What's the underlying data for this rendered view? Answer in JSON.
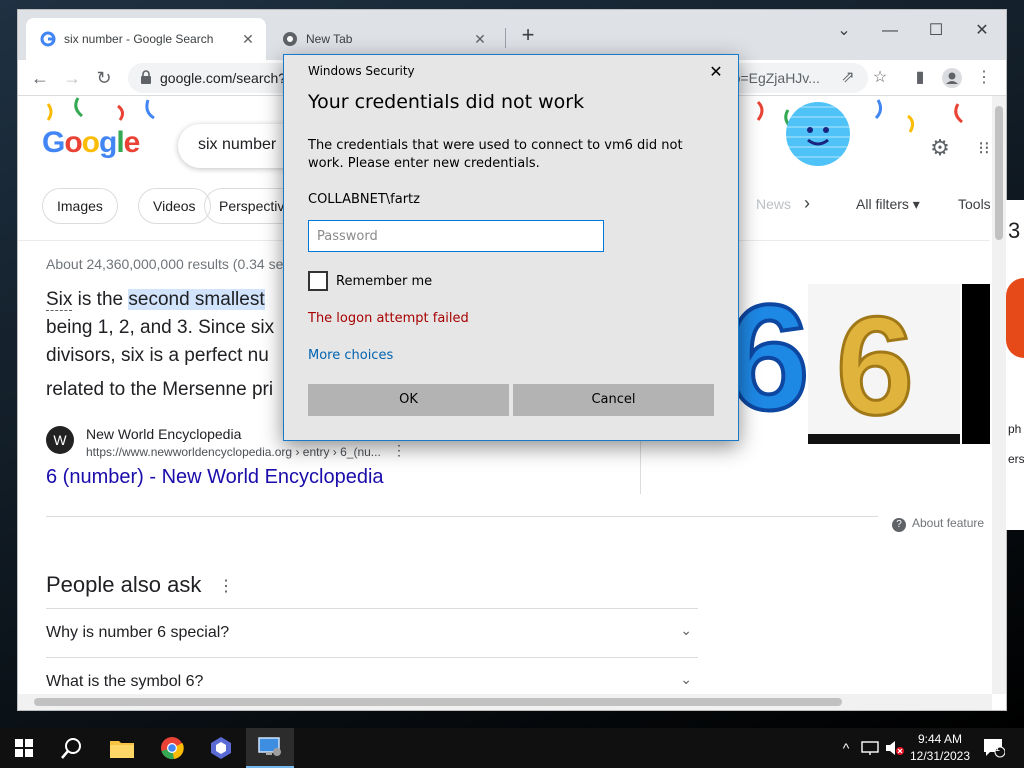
{
  "browser": {
    "tabs": [
      {
        "title": "six number - Google Search",
        "close": "✕"
      },
      {
        "title": "New Tab",
        "close": "✕"
      }
    ],
    "new_tab": "+",
    "window_controls": {
      "minimize": "—",
      "maximize": "☐",
      "close": "✕",
      "tabsearch": "⌄"
    },
    "address": {
      "url": "google.com/search?",
      "url_tail": "rp=EgZjaHJv..."
    }
  },
  "google": {
    "logo_letters": [
      {
        "ch": "G",
        "color": "#4285f4"
      },
      {
        "ch": "o",
        "color": "#ea4335"
      },
      {
        "ch": "o",
        "color": "#fbbc05"
      },
      {
        "ch": "g",
        "color": "#4285f4"
      },
      {
        "ch": "l",
        "color": "#34a853"
      },
      {
        "ch": "e",
        "color": "#ea4335"
      }
    ],
    "query": "six number",
    "chips": [
      "Images",
      "Videos",
      "Perspectiv",
      "News"
    ],
    "all_filters": "All filters",
    "tools": "Tools",
    "stats": "About 24,360,000,000 results (0.34 se",
    "snippet_lines": {
      "l1_a": "Six",
      "l1_b": " is the ",
      "l1_hl": "second smallest",
      "l2": "being 1, 2, and 3. Since six",
      "l3": "divisors, six is a perfect nu",
      "l4": "related to the Mersenne pri"
    },
    "source": {
      "logo": "W",
      "name": "New World Encyclopedia",
      "url": "https://www.newworldencyclopedia.org › entry › 6_(nu..."
    },
    "result_title": "6 (number) - New World Encyclopedia",
    "about_featured": "About feature",
    "paa_title": "People also ask",
    "paa_questions": [
      "Why is number 6 special?",
      "What is the symbol 6?"
    ],
    "side_glimpse": {
      "num": "3",
      "ph": "ph",
      "ers": "ers"
    }
  },
  "dialog": {
    "window_title": "Windows Security",
    "heading": "Your credentials did not work",
    "message": "The credentials that were used to connect to vm6 did not work. Please enter new credentials.",
    "username": "COLLABNET\\fartz",
    "password_placeholder": "Password",
    "remember_label": "Remember me",
    "error": "The logon attempt failed",
    "more_choices": "More choices",
    "ok": "OK",
    "cancel": "Cancel"
  },
  "taskbar": {
    "time": "9:44 AM",
    "date": "12/31/2023",
    "notification_count": "1"
  },
  "colors": {
    "accent": "#0078d7",
    "error": "#a80000",
    "link": "#1a0dab"
  }
}
